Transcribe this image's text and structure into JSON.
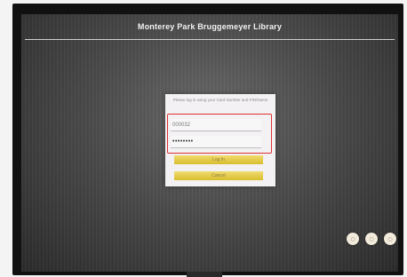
{
  "header": {
    "title": "Monterey Park Bruggemeyer Library"
  },
  "login": {
    "prompt": "Please log in using your Card Number and PIN/Name",
    "card_number_value": "000032",
    "pin_value": "••••••••",
    "login_button": "Log In",
    "cancel_button": "Cancel"
  },
  "corner_buttons": [
    {
      "icon": "globe-icon",
      "glyph": "○"
    },
    {
      "icon": "help-icon",
      "glyph": "○"
    },
    {
      "icon": "info-icon",
      "glyph": "○"
    }
  ],
  "colors": {
    "button_yellow": "#e6c84a",
    "highlight_red": "#e03030"
  }
}
